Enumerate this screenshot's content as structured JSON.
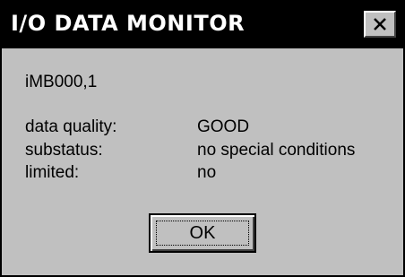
{
  "window": {
    "title": "I/O DATA MONITOR",
    "close_icon": "close-x-icon"
  },
  "content": {
    "address": "iMB000,1",
    "rows": [
      {
        "label": "data quality:",
        "value": "GOOD"
      },
      {
        "label": "substatus:",
        "value": "no special conditions"
      },
      {
        "label": "limited:",
        "value": "no"
      }
    ]
  },
  "buttons": {
    "ok_label": "OK"
  },
  "colors": {
    "titlebar": "#000000",
    "title_text": "#ffffff",
    "face": "#c0c0c0"
  }
}
